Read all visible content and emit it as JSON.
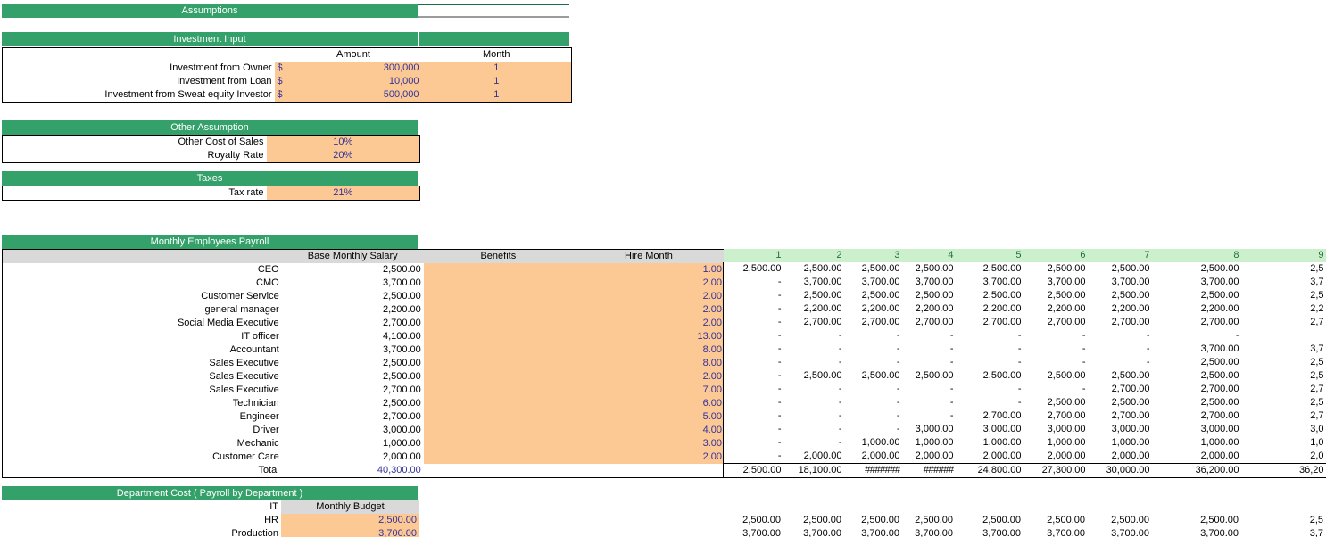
{
  "colors": {
    "band_green": "#34a06a",
    "band_rule": "#1f6b46",
    "input_fill": "#fcc894",
    "input_text": "#333399",
    "header_gray": "#d9d9d9",
    "month_header": "#ccf0cc",
    "month_header_text": "#1f6b46"
  },
  "titles": {
    "assumptions": "Assumptions",
    "investment_input": "Investment Input",
    "other_assumption": "Other Assumption",
    "taxes": "Taxes",
    "monthly_employees_payroll": "Monthly Employees Payroll",
    "department_cost": "Department Cost ( Payroll by Department )"
  },
  "investment": {
    "headers": {
      "amount": "Amount",
      "month": "Month"
    },
    "currency_symbol": "$",
    "rows": [
      {
        "label": "Investment from Owner",
        "amount": "300,000",
        "month": "1"
      },
      {
        "label": "Investment from Loan",
        "amount": "10,000",
        "month": "1"
      },
      {
        "label": "Investment from Sweat equity Investor",
        "amount": "500,000",
        "month": "1"
      }
    ]
  },
  "other_assumption": {
    "rows": [
      {
        "label": "Other Cost of Sales",
        "value": "10%"
      },
      {
        "label": "Royalty Rate",
        "value": "20%"
      }
    ]
  },
  "taxes": {
    "rows": [
      {
        "label": "Tax rate",
        "value": "21%"
      }
    ]
  },
  "payroll": {
    "headers": {
      "base_monthly_salary": "Base Monthly Salary",
      "benefits": "Benefits",
      "hire_month": "Hire Month"
    },
    "month_columns": [
      "1",
      "2",
      "3",
      "4",
      "5",
      "6",
      "7",
      "8",
      "9"
    ],
    "rows": [
      {
        "name": "CEO",
        "salary": "2,500.00",
        "benefits": "",
        "hire_month": "1.00",
        "months": [
          "2,500.00",
          "2,500.00",
          "2,500.00",
          "2,500.00",
          "2,500.00",
          "2,500.00",
          "2,500.00",
          "2,500.00",
          "2,5"
        ]
      },
      {
        "name": "CMO",
        "salary": "3,700.00",
        "benefits": "",
        "hire_month": "2.00",
        "months": [
          "-",
          "3,700.00",
          "3,700.00",
          "3,700.00",
          "3,700.00",
          "3,700.00",
          "3,700.00",
          "3,700.00",
          "3,7"
        ]
      },
      {
        "name": "Customer Service",
        "salary": "2,500.00",
        "benefits": "",
        "hire_month": "2.00",
        "months": [
          "-",
          "2,500.00",
          "2,500.00",
          "2,500.00",
          "2,500.00",
          "2,500.00",
          "2,500.00",
          "2,500.00",
          "2,5"
        ]
      },
      {
        "name": "general manager",
        "salary": "2,200.00",
        "benefits": "",
        "hire_month": "2.00",
        "months": [
          "-",
          "2,200.00",
          "2,200.00",
          "2,200.00",
          "2,200.00",
          "2,200.00",
          "2,200.00",
          "2,200.00",
          "2,2"
        ]
      },
      {
        "name": "Social Media Executive",
        "salary": "2,700.00",
        "benefits": "",
        "hire_month": "2.00",
        "months": [
          "-",
          "2,700.00",
          "2,700.00",
          "2,700.00",
          "2,700.00",
          "2,700.00",
          "2,700.00",
          "2,700.00",
          "2,7"
        ]
      },
      {
        "name": "IT officer",
        "salary": "4,100.00",
        "benefits": "",
        "hire_month": "13.00",
        "months": [
          "-",
          "-",
          "-",
          "-",
          "-",
          "-",
          "-",
          "-",
          ""
        ]
      },
      {
        "name": "Accountant",
        "salary": "3,700.00",
        "benefits": "",
        "hire_month": "8.00",
        "months": [
          "-",
          "-",
          "-",
          "-",
          "-",
          "-",
          "-",
          "3,700.00",
          "3,7"
        ]
      },
      {
        "name": "Sales Executive",
        "salary": "2,500.00",
        "benefits": "",
        "hire_month": "8.00",
        "months": [
          "-",
          "-",
          "-",
          "-",
          "-",
          "-",
          "-",
          "2,500.00",
          "2,5"
        ]
      },
      {
        "name": "Sales Executive",
        "salary": "2,500.00",
        "benefits": "",
        "hire_month": "2.00",
        "months": [
          "-",
          "2,500.00",
          "2,500.00",
          "2,500.00",
          "2,500.00",
          "2,500.00",
          "2,500.00",
          "2,500.00",
          "2,5"
        ]
      },
      {
        "name": "Sales Executive",
        "salary": "2,700.00",
        "benefits": "",
        "hire_month": "7.00",
        "months": [
          "-",
          "-",
          "-",
          "-",
          "-",
          "-",
          "2,700.00",
          "2,700.00",
          "2,7"
        ]
      },
      {
        "name": "Technician",
        "salary": "2,500.00",
        "benefits": "",
        "hire_month": "6.00",
        "months": [
          "-",
          "-",
          "-",
          "-",
          "-",
          "2,500.00",
          "2,500.00",
          "2,500.00",
          "2,5"
        ]
      },
      {
        "name": "Engineer",
        "salary": "2,700.00",
        "benefits": "",
        "hire_month": "5.00",
        "months": [
          "-",
          "-",
          "-",
          "-",
          "2,700.00",
          "2,700.00",
          "2,700.00",
          "2,700.00",
          "2,7"
        ]
      },
      {
        "name": "Driver",
        "salary": "3,000.00",
        "benefits": "",
        "hire_month": "4.00",
        "months": [
          "-",
          "-",
          "-",
          "3,000.00",
          "3,000.00",
          "3,000.00",
          "3,000.00",
          "3,000.00",
          "3,0"
        ]
      },
      {
        "name": "Mechanic",
        "salary": "1,000.00",
        "benefits": "",
        "hire_month": "3.00",
        "months": [
          "-",
          "-",
          "1,000.00",
          "1,000.00",
          "1,000.00",
          "1,000.00",
          "1,000.00",
          "1,000.00",
          "1,0"
        ]
      },
      {
        "name": "Customer Care",
        "salary": "2,000.00",
        "benefits": "",
        "hire_month": "2.00",
        "months": [
          "-",
          "2,000.00",
          "2,000.00",
          "2,000.00",
          "2,000.00",
          "2,000.00",
          "2,000.00",
          "2,000.00",
          "2,0"
        ]
      }
    ],
    "total": {
      "label": "Total",
      "salary": "40,300.00",
      "benefits": "",
      "hire_month": "-",
      "months": [
        "2,500.00",
        "18,100.00",
        "#######",
        "######",
        "24,800.00",
        "27,300.00",
        "30,000.00",
        "36,200.00",
        "36,20"
      ]
    }
  },
  "department_cost": {
    "headers": {
      "monthly_budget": "Monthly Budget"
    },
    "rows": [
      {
        "name": "IT",
        "budget": "",
        "months": [
          "",
          "",
          "",
          "",
          "",
          "",
          "",
          "",
          ""
        ]
      },
      {
        "name": "HR",
        "budget": "2,500.00",
        "months": [
          "2,500.00",
          "2,500.00",
          "2,500.00",
          "2,500.00",
          "2,500.00",
          "2,500.00",
          "2,500.00",
          "2,500.00",
          "2,5"
        ]
      },
      {
        "name": "Production",
        "budget": "3,700.00",
        "months": [
          "3,700.00",
          "3,700.00",
          "3,700.00",
          "3,700.00",
          "3,700.00",
          "3,700.00",
          "3,700.00",
          "3,700.00",
          "3,7"
        ]
      }
    ]
  }
}
